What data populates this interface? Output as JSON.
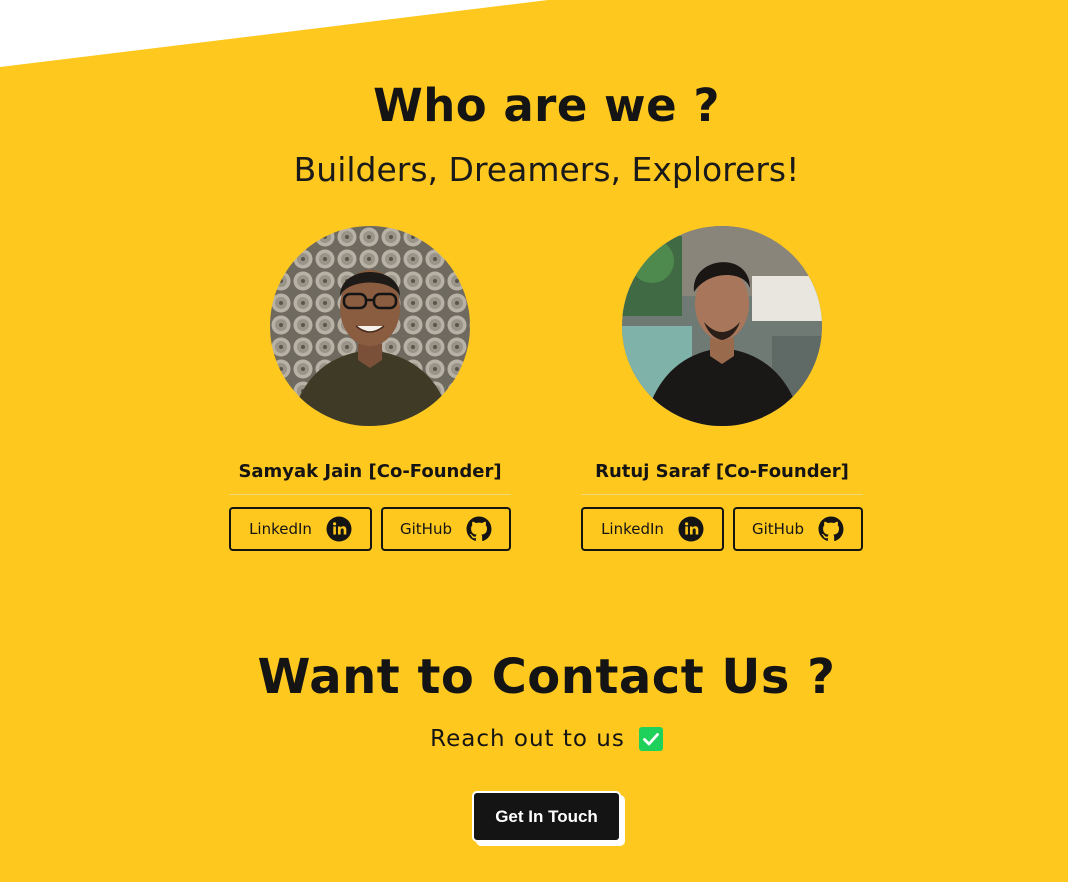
{
  "about": {
    "title": "Who are we ?",
    "subtitle": "Builders, Dreamers, Explorers!"
  },
  "team": [
    {
      "name": "Samyak Jain [Co-Founder]",
      "linkedin_label": "LinkedIn",
      "github_label": "GitHub"
    },
    {
      "name": "Rutuj Saraf [Co-Founder]",
      "linkedin_label": "LinkedIn",
      "github_label": "GitHub"
    }
  ],
  "contact": {
    "title": "Want to Contact Us ?",
    "reach_text": "Reach out to us",
    "cta_label": "Get In Touch",
    "check_icon": "check-box-icon"
  },
  "icons": {
    "linkedin": "linkedin-icon",
    "github": "github-icon"
  },
  "colors": {
    "background": "#FEC81F",
    "text": "#141414",
    "cta_background": "#141414",
    "cta_text": "#FFFFFF",
    "check_green": "#1DD15A"
  }
}
